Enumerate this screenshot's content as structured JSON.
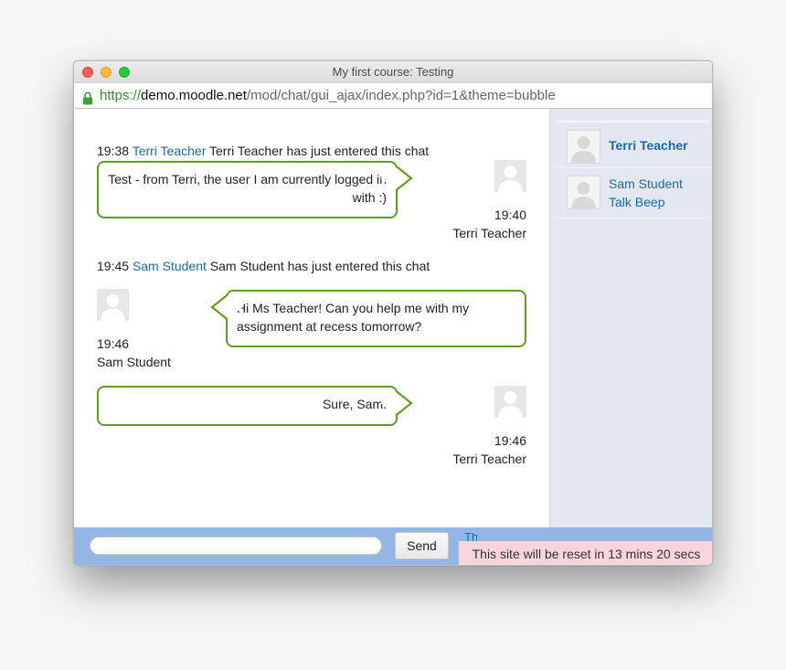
{
  "window": {
    "title": "My first course: Testing",
    "url": {
      "scheme": "https://",
      "host": "demo.moodle.net",
      "path": "/mod/chat/gui_ajax/index.php?id=1&theme=bubble"
    }
  },
  "messages": {
    "sys1": {
      "time": "19:38",
      "user": "Terri Teacher",
      "text": "Terri Teacher has just entered this chat"
    },
    "msg1": {
      "text": "Test - from Terri, the user I am currently logged in with :)",
      "time": "19:40",
      "user": "Terri Teacher"
    },
    "sys2": {
      "time": "19:45",
      "user": "Sam Student",
      "text": "Sam Student has just entered this chat"
    },
    "msg2": {
      "text": "Hi Ms Teacher! Can you help me with my assignment at recess tomorrow?",
      "time": "19:46",
      "user": "Sam Student"
    },
    "msg3": {
      "text": "Sure, Sam.",
      "time": "19:46",
      "user": "Terri Teacher"
    }
  },
  "users": {
    "u1": {
      "name": "Terri Teacher"
    },
    "u2": {
      "name": "Sam Student",
      "talk": "Talk",
      "beep": "Beep"
    }
  },
  "input": {
    "send_label": "Send",
    "themes_label": "Th"
  },
  "notice": {
    "reset": "This site will be reset in 13 mins 20 secs"
  },
  "colors": {
    "bubble_border": "#5f9e1f",
    "link": "#1a6aa8",
    "bottom_bar": "#93b6e4",
    "notice_bg": "#f8d5da",
    "users_pane": "#e3e8f0"
  }
}
